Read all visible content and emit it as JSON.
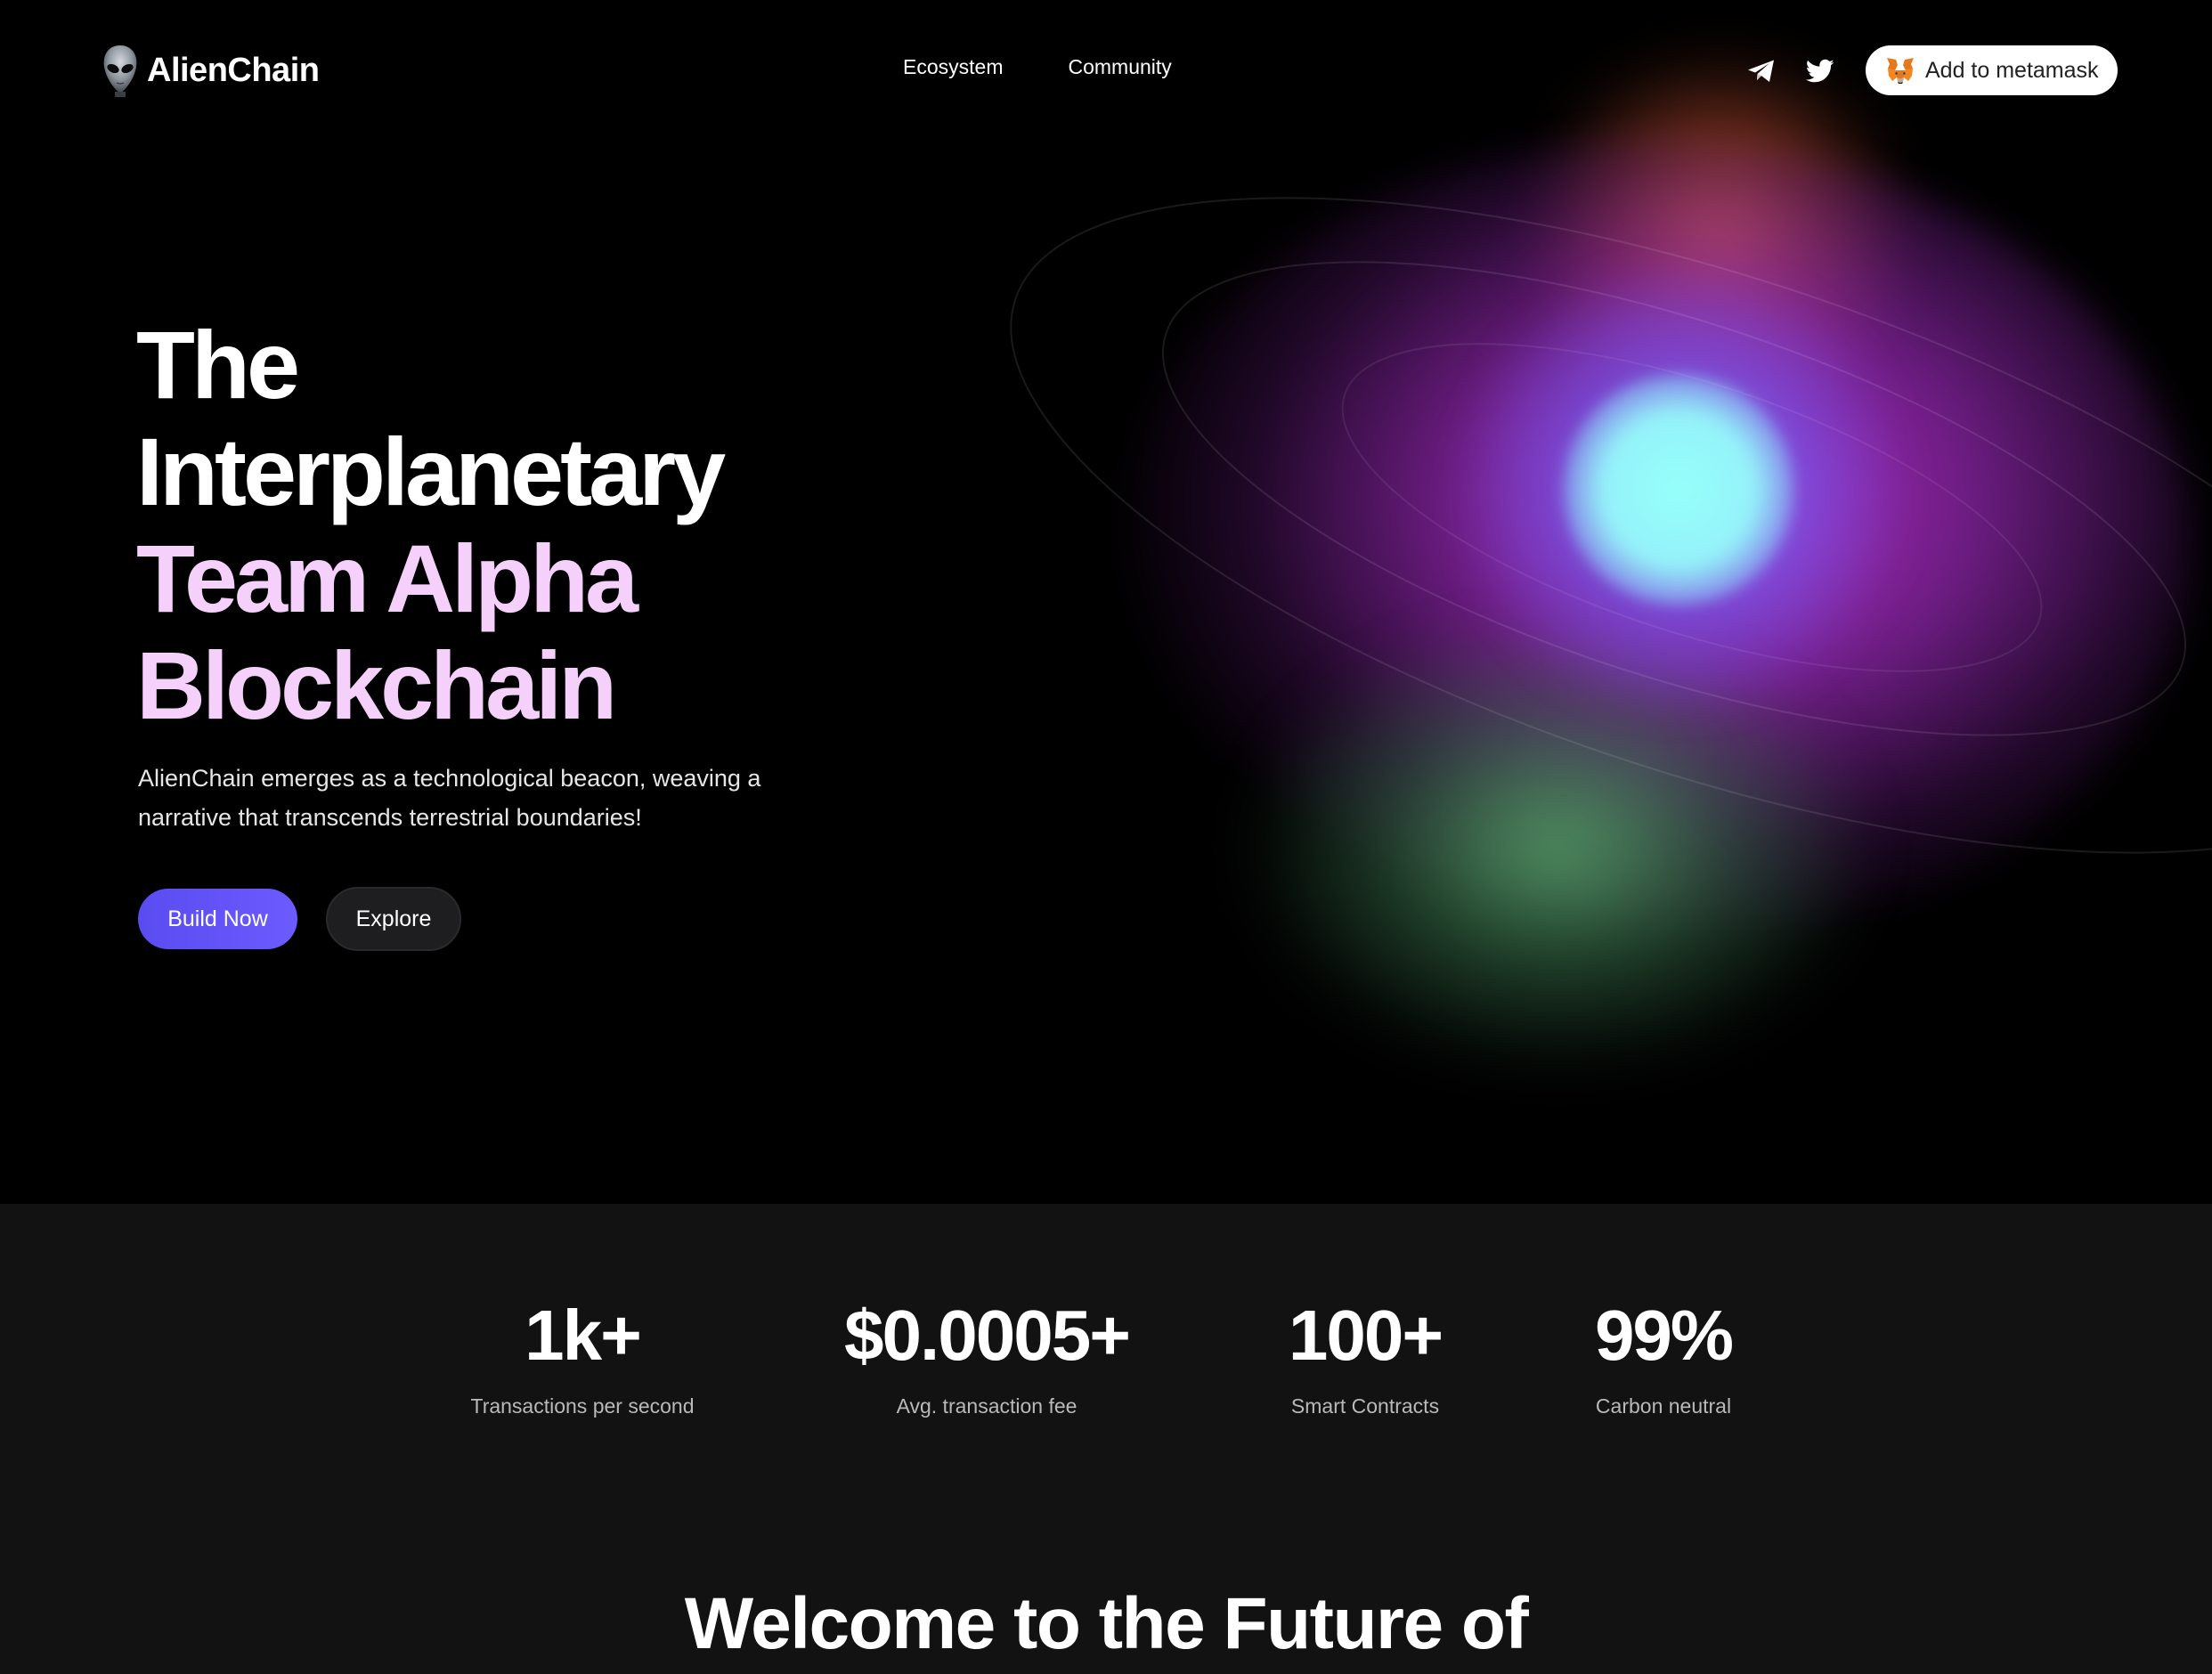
{
  "nav": {
    "brand": "AlienChain",
    "links": [
      "Ecosystem",
      "Community"
    ],
    "social": [
      "telegram-icon",
      "twitter-icon"
    ],
    "metamask_label": "Add to metamask"
  },
  "hero": {
    "title_line_1": "The",
    "title_line_2": "Interplanetary",
    "title_line_3": "Team Alpha",
    "title_line_4": "Blockchain",
    "description": "AlienChain emerges as a technological beacon, weaving a narrative that transcends terrestrial boundaries!",
    "primary_button": "Build Now",
    "secondary_button": "Explore"
  },
  "stats": [
    {
      "value": "1k+",
      "label": "Transactions per second"
    },
    {
      "value": "$0.0005+",
      "label": "Avg. transaction fee"
    },
    {
      "value": "100+",
      "label": "Smart Contracts"
    },
    {
      "value": "99%",
      "label": "Carbon neutral"
    }
  ],
  "welcome_heading": "Welcome to the Future of",
  "colors": {
    "accent": "#6c5bff",
    "title_pink": "#f5d0fb",
    "stats_bg": "#121212"
  }
}
